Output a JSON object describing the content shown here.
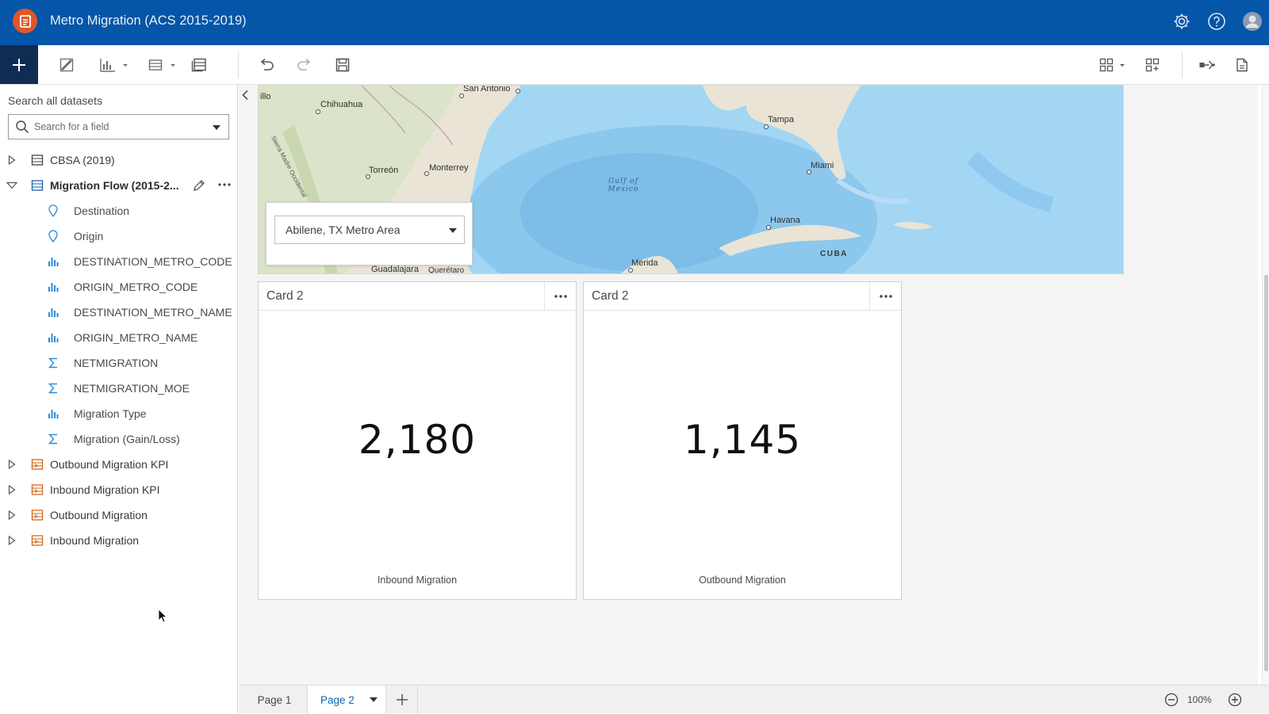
{
  "header": {
    "app_title": "Metro Migration (ACS 2015-2019)",
    "icons": [
      "app-logo-icon",
      "settings-gear-icon",
      "help-icon",
      "user-avatar"
    ]
  },
  "toolbar": {
    "add_icon": "plus-icon",
    "tools": [
      "map-icon",
      "chart-icon",
      "table-icon",
      "data-table-icon",
      "undo-icon",
      "redo-icon",
      "save-icon",
      "layout-icon",
      "grid-icon",
      "analysis-icon",
      "page-icon"
    ]
  },
  "left_panel": {
    "search_label": "Search all datasets",
    "search_placeholder": "Search for a field",
    "datasets": [
      {
        "label": "CBSA (2019)",
        "expanded": false
      },
      {
        "label": "Migration Flow (2015-2...",
        "expanded": true
      }
    ],
    "fields": [
      {
        "label": "Destination",
        "type": "location"
      },
      {
        "label": "Origin",
        "type": "location"
      },
      {
        "label": "DESTINATION_METRO_CODE",
        "type": "string"
      },
      {
        "label": "ORIGIN_METRO_CODE",
        "type": "string"
      },
      {
        "label": "DESTINATION_METRO_NAME",
        "type": "string"
      },
      {
        "label": "ORIGIN_METRO_NAME",
        "type": "string"
      },
      {
        "label": "NETMIGRATION",
        "type": "number"
      },
      {
        "label": "NETMIGRATION_MOE",
        "type": "number"
      },
      {
        "label": "Migration Type",
        "type": "string"
      },
      {
        "label": "Migration (Gain/Loss)",
        "type": "number"
      }
    ],
    "result_datasets": [
      {
        "label": "Outbound Migration KPI"
      },
      {
        "label": "Inbound Migration KPI"
      },
      {
        "label": "Outbound Migration"
      },
      {
        "label": "Inbound Migration"
      }
    ]
  },
  "map": {
    "labels": {
      "san_antonio": "San Antonio",
      "chihuahua": "Chihuahua",
      "illo": "illo",
      "torreon": "Torreón",
      "monterrey": "Monterrey",
      "gulf_line1": "Gulf of",
      "gulf_line2": "Mexico",
      "tampa": "Tampa",
      "miami": "Miami",
      "havana": "Havana",
      "cuba": "CUBA",
      "merida": "Merida",
      "guadalajara": "Guadalajara",
      "queretaro": "Querétaro",
      "sierra": "Sierra Madre Occidental"
    },
    "filter_value": "Abilene, TX Metro Area"
  },
  "cards": [
    {
      "title": "Card 2",
      "value": "2,180",
      "caption": "Inbound Migration"
    },
    {
      "title": "Card 2",
      "value": "1,145",
      "caption": "Outbound Migration"
    }
  ],
  "pages": {
    "page1": "Page 1",
    "page2": "Page 2",
    "zoom": "100%"
  },
  "colors": {
    "header_bg": "#0555a8",
    "add_button_bg": "#0f2c52",
    "logo": "#e0582a",
    "accent_blue": "#0d67b3"
  }
}
